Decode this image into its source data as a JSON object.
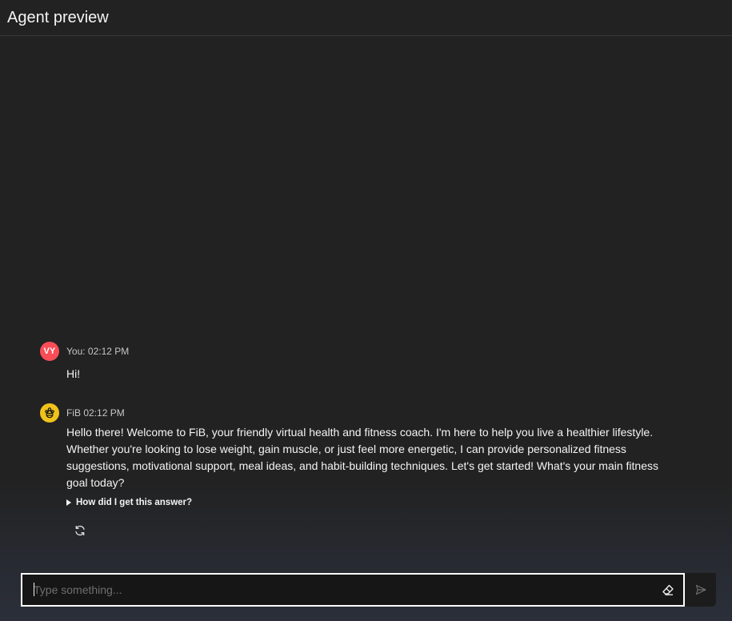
{
  "header": {
    "title": "Agent preview"
  },
  "messages": [
    {
      "sender": "user",
      "avatar_initials": "VY",
      "meta": "You: 02:12 PM",
      "text": "Hi!"
    },
    {
      "sender": "bot",
      "avatar_icon": "bee-icon",
      "meta": "FiB 02:12 PM",
      "text": "Hello there! Welcome to FiB, your friendly virtual health and fitness coach. I'm here to help you live a healthier lifestyle. Whether you're looking to lose weight, gain muscle, or just feel more energetic, I can provide personalized fitness suggestions, motivational support, meal ideas, and habit-building techniques. Let's get started! What's your main fitness goal today?",
      "explain_label": "How did I get this answer?",
      "regenerate_icon": "regenerate-icon"
    }
  ],
  "input": {
    "placeholder": "Type something...",
    "value": "",
    "clear_icon": "eraser-icon",
    "send_icon": "send-icon"
  },
  "colors": {
    "background": "#222222",
    "user_avatar": "#fa4d56",
    "bot_avatar": "#f1c21b",
    "input_border": "#ffffff"
  }
}
